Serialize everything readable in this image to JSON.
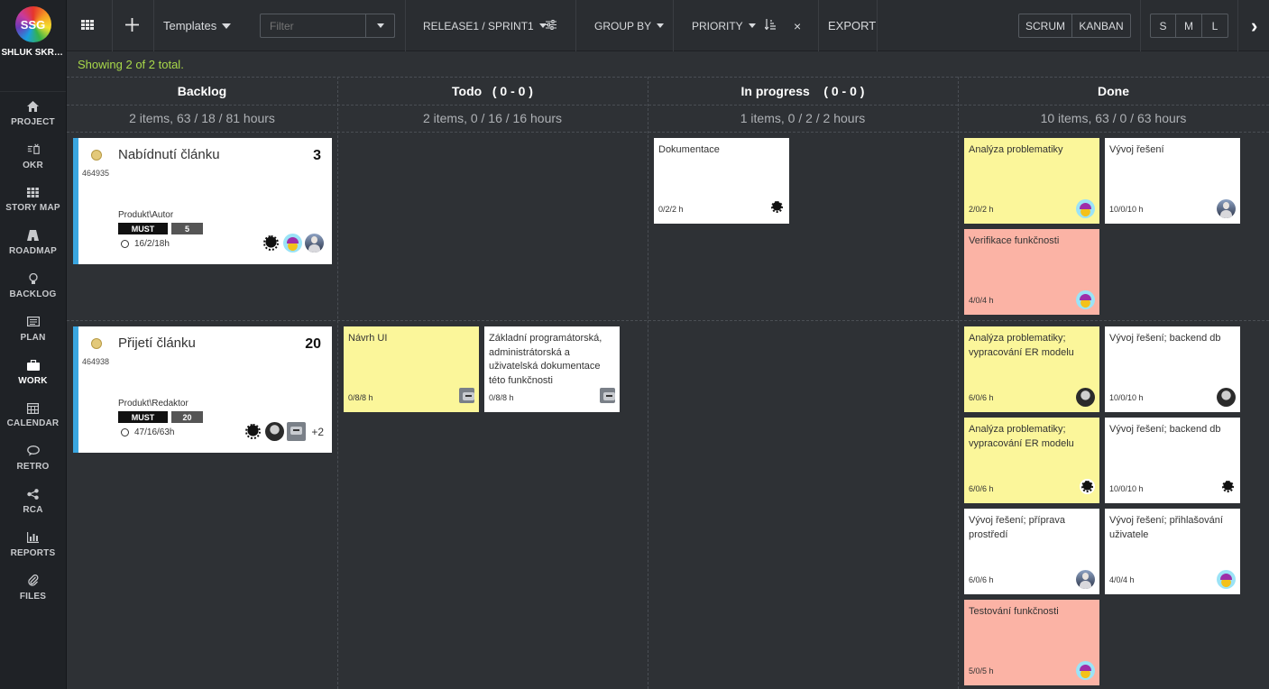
{
  "sidebar": {
    "logo_text": "SSG",
    "org_name": "SHLUK SKROMNÝCH...",
    "items": [
      {
        "label": "PROJECT",
        "icon": "home-icon"
      },
      {
        "label": "OKR",
        "icon": "okr-icon"
      },
      {
        "label": "STORY MAP",
        "icon": "grid-icon"
      },
      {
        "label": "ROADMAP",
        "icon": "road-icon"
      },
      {
        "label": "BACKLOG",
        "icon": "bulb-icon"
      },
      {
        "label": "PLAN",
        "icon": "list-icon"
      },
      {
        "label": "WORK",
        "icon": "briefcase-icon",
        "active": true
      },
      {
        "label": "CALENDAR",
        "icon": "calendar-icon"
      },
      {
        "label": "RETRO",
        "icon": "chat-icon"
      },
      {
        "label": "RCA",
        "icon": "share-icon"
      },
      {
        "label": "REPORTS",
        "icon": "chart-icon"
      },
      {
        "label": "FILES",
        "icon": "paperclip-icon"
      }
    ]
  },
  "toolbar": {
    "templates_label": "Templates",
    "filter_placeholder": "Filter",
    "sprint_label": "RELEASE1 / SPRINT1",
    "group_by_label": "GROUP BY",
    "priority_label": "PRIORITY",
    "close_label": "×",
    "export_label": "EXPORT",
    "mode_scrum": "SCRUM",
    "mode_kanban": "KANBAN",
    "size_s": "S",
    "size_m": "M",
    "size_l": "L",
    "next_label": "›"
  },
  "status_text": "Showing 2 of 2 total.",
  "columns": [
    {
      "title": "Backlog",
      "summary": "2 items, 63 / 18 / 81 hours"
    },
    {
      "title": "Todo   ( 0 - 0 )",
      "summary": "2 items, 0 / 16 / 16 hours"
    },
    {
      "title": "In progress    ( 0 - 0 )",
      "summary": "1 items, 0 / 2 / 2 hours"
    },
    {
      "title": "Done",
      "summary": "10 items, 63 / 0 / 63 hours"
    }
  ],
  "stories": [
    {
      "id": "464935",
      "title": "Nabídnutí článku",
      "points": "3",
      "path": "Produkt\\Autor",
      "priority": "MUST",
      "badge": "5",
      "hours": "16/2/18h",
      "more": ""
    },
    {
      "id": "464938",
      "title": "Přijetí článku",
      "points": "20",
      "path": "Produkt\\Redaktor",
      "priority": "MUST",
      "badge": "20",
      "hours": "47/16/63h",
      "more": "+2"
    }
  ],
  "tasks": {
    "t1": {
      "title": "Dokumentace",
      "hours": "0/2/2 h"
    },
    "t2": {
      "title": "Analýza problematiky",
      "hours": "2/0/2 h"
    },
    "t3": {
      "title": "Vývoj řešení",
      "hours": "10/0/10 h"
    },
    "t4": {
      "title": "Verifikace funkčnosti",
      "hours": "4/0/4 h"
    },
    "t5": {
      "title": "Návrh UI",
      "hours": "0/8/8 h"
    },
    "t6": {
      "title": "Základní programátorská, administrátorská a uživatelská dokumentace této funkčnosti",
      "hours": "0/8/8 h"
    },
    "t7": {
      "title": "Analýza problematiky; vypracování ER modelu",
      "hours": "6/0/6 h"
    },
    "t8": {
      "title": "Vývoj řešení; backend db",
      "hours": "10/0/10 h"
    },
    "t9": {
      "title": "Analýza problematiky; vypracování ER modelu",
      "hours": "6/0/6 h"
    },
    "t10": {
      "title": "Vývoj řešení; backend db",
      "hours": "10/0/10 h"
    },
    "t11": {
      "title": "Vývoj řešení; příprava prostředí",
      "hours": "6/0/6 h"
    },
    "t12": {
      "title": "Vývoj řešení; přihlašování uživatele",
      "hours": "4/0/4 h"
    },
    "t13": {
      "title": "Testování funkčnosti",
      "hours": "5/0/5 h"
    }
  }
}
